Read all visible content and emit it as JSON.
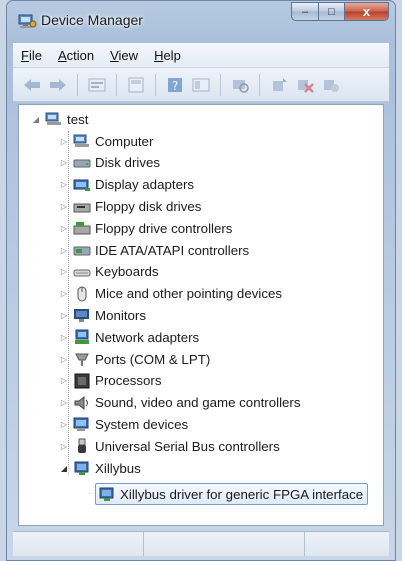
{
  "window": {
    "title": "Device Manager",
    "caption_buttons": {
      "minimize": "–",
      "maximize": "□",
      "close": "x"
    }
  },
  "menu": [
    {
      "pre": "",
      "u": "F",
      "post": "ile"
    },
    {
      "pre": "",
      "u": "A",
      "post": "ction"
    },
    {
      "pre": "",
      "u": "V",
      "post": "iew"
    },
    {
      "pre": "",
      "u": "H",
      "post": "elp"
    }
  ],
  "toolbar": [
    "back-arrow-icon",
    "forward-arrow-icon",
    "properties-icon",
    "show-hide-icon",
    "help-icon",
    "view-icon",
    "scan-hardware-icon",
    "update-driver-icon",
    "uninstall-icon",
    "disable-icon"
  ],
  "tree": {
    "root": {
      "label": "test",
      "expander": "◢",
      "icon": "computer-icon"
    },
    "categories": [
      {
        "label": "Computer",
        "icon": "computer-icon"
      },
      {
        "label": "Disk drives",
        "icon": "disk-drive-icon"
      },
      {
        "label": "Display adapters",
        "icon": "display-adapter-icon"
      },
      {
        "label": "Floppy disk drives",
        "icon": "floppy-disk-icon"
      },
      {
        "label": "Floppy drive controllers",
        "icon": "floppy-controller-icon"
      },
      {
        "label": "IDE ATA/ATAPI controllers",
        "icon": "ide-controller-icon"
      },
      {
        "label": "Keyboards",
        "icon": "keyboard-icon"
      },
      {
        "label": "Mice and other pointing devices",
        "icon": "mouse-icon"
      },
      {
        "label": "Monitors",
        "icon": "monitor-icon"
      },
      {
        "label": "Network adapters",
        "icon": "network-adapter-icon"
      },
      {
        "label": "Ports (COM & LPT)",
        "icon": "port-icon"
      },
      {
        "label": "Processors",
        "icon": "processor-icon"
      },
      {
        "label": "Sound, video and game controllers",
        "icon": "sound-icon"
      },
      {
        "label": "System devices",
        "icon": "system-device-icon"
      },
      {
        "label": "Universal Serial Bus controllers",
        "icon": "usb-icon"
      },
      {
        "label": "Xillybus",
        "icon": "xillybus-icon",
        "expanded": true
      }
    ],
    "child": {
      "label": "Xillybus driver for generic FPGA interface",
      "icon": "fpga-device-icon",
      "selected": true
    },
    "collapsed_glyph": "▷",
    "expanded_glyph": "◢"
  },
  "colors": {
    "window_frame": "#a9c0db",
    "tree_bg": "#ffffff",
    "selection_border": "#7a9bc4",
    "icon_blue": "#2f6fb5",
    "icon_green": "#3c9a3a"
  }
}
